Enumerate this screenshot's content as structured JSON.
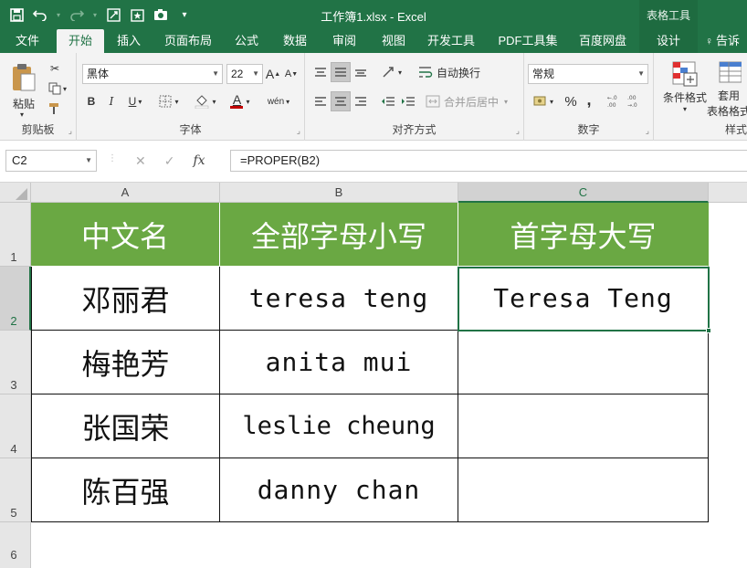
{
  "window": {
    "title": "工作簿1.xlsx - Excel",
    "context_tab_group": "表格工具"
  },
  "qat": {
    "icons": [
      "save-icon",
      "undo-icon",
      "redo-icon",
      "form-icon",
      "star-icon",
      "camera-icon",
      "customize-icon"
    ]
  },
  "tabs": [
    {
      "label": "文件"
    },
    {
      "label": "开始"
    },
    {
      "label": "插入"
    },
    {
      "label": "页面布局"
    },
    {
      "label": "公式"
    },
    {
      "label": "数据"
    },
    {
      "label": "审阅"
    },
    {
      "label": "视图"
    },
    {
      "label": "开发工具"
    },
    {
      "label": "PDF工具集"
    },
    {
      "label": "百度网盘"
    },
    {
      "label": "设计"
    },
    {
      "label": "告诉"
    }
  ],
  "ribbon": {
    "clipboard": {
      "paste_label": "粘贴",
      "group_label": "剪贴板"
    },
    "font": {
      "font_name": "黑体",
      "font_size": "22",
      "group_label": "字体",
      "bold": "B",
      "italic": "I",
      "underline": "U",
      "grow": "A",
      "shrink": "A",
      "font_color": "A",
      "phonetic": "wén"
    },
    "alignment": {
      "wrap_label": "自动换行",
      "merge_label": "合并后居中",
      "group_label": "对齐方式"
    },
    "number": {
      "format": "常规",
      "percent": "%",
      "comma": ",",
      "group_label": "数字"
    },
    "styles": {
      "conditional_label": "条件格式",
      "table_label_1": "套用",
      "table_label_2": "表格格式",
      "group_label": "样式"
    }
  },
  "formula_bar": {
    "name_box": "C2",
    "cancel": "✕",
    "confirm": "✓",
    "fx": "fx",
    "formula": "=PROPER(B2)"
  },
  "sheet": {
    "columns": [
      "A",
      "B",
      "C"
    ],
    "rows": [
      "1",
      "2",
      "3",
      "4",
      "5",
      "6"
    ],
    "header": [
      "中文名",
      "全部字母小写",
      "首字母大写"
    ],
    "data": [
      [
        "邓丽君",
        "teresa teng",
        "Teresa Teng"
      ],
      [
        "梅艳芳",
        "anita mui",
        ""
      ],
      [
        "张国荣",
        "leslie cheung",
        ""
      ],
      [
        "陈百强",
        "danny chan",
        ""
      ]
    ],
    "header_color": "#6aa843",
    "accent_color": "#217346"
  }
}
